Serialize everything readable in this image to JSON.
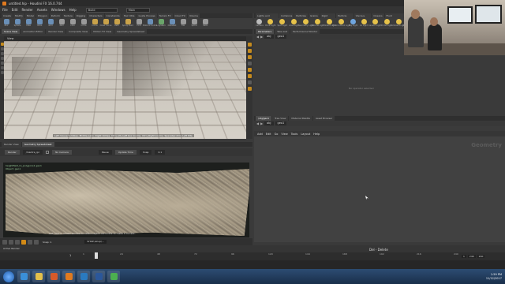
{
  "title_bar": {
    "title": "untitled.hip - Houdini FX 16.0.744"
  },
  "menu": {
    "items": [
      "File",
      "Edit",
      "Render",
      "Assets",
      "Windows",
      "Help"
    ],
    "desktop": "Build",
    "main_dropdown": "Main"
  },
  "shelf_tabs": [
    "Create",
    "Modify",
    "Model",
    "Polygon",
    "Deform",
    "Texture",
    "Rigging",
    "Characters",
    "Constraints",
    "Hair Utils",
    "Guide Process",
    "Terrain FX",
    "Cloud FX",
    "Volume"
  ],
  "shelf_tools": [
    {
      "label": "Box",
      "color": "#6a8fb7"
    },
    {
      "label": "Sphere",
      "color": "#6a8fb7"
    },
    {
      "label": "Tube",
      "color": "#6a8fb7"
    },
    {
      "label": "Torus",
      "color": "#6a8fb7"
    },
    {
      "label": "Grid",
      "color": "#6a8fb7"
    },
    {
      "label": "Null",
      "color": "#9a9a9a"
    },
    {
      "label": "Line",
      "color": "#9a9a9a"
    },
    {
      "label": "Circle",
      "color": "#9a9a9a"
    },
    {
      "label": "Curve",
      "color": "#c9a24a"
    },
    {
      "label": "Draw Curve",
      "color": "#c9a24a"
    },
    {
      "label": "Path",
      "color": "#c9a24a"
    },
    {
      "label": "Spray Paint",
      "color": "#c9a24a"
    },
    {
      "label": "Font",
      "color": "#9a9a9a"
    },
    {
      "label": "Platonic Solids",
      "color": "#6a8fb7"
    },
    {
      "label": "L-System",
      "color": "#6aa56a"
    },
    {
      "label": "Metaball",
      "color": "#6a8fb7"
    },
    {
      "label": "File",
      "color": "#9a9a9a"
    },
    {
      "label": "Spiral",
      "color": "#9a9a9a"
    },
    {
      "label": "Helix",
      "color": "#9a9a9a"
    }
  ],
  "right_shelf_tabs": [
    "Lights and Cameras",
    "Collisions",
    "Particles",
    "Grains",
    "Rigid Bodies",
    "Particle Fluids",
    "Viscous Fluids",
    "Oceans",
    "Fluid Containers"
  ],
  "right_shelf_tools": [
    {
      "label": "Camera",
      "color": "#bbbbbb"
    },
    {
      "label": "Point Light",
      "color": "#e6c24a"
    },
    {
      "label": "Spot Light",
      "color": "#e6c24a"
    },
    {
      "label": "Area Light",
      "color": "#e6c24a"
    },
    {
      "label": "Geometry Light",
      "color": "#e6c24a"
    },
    {
      "label": "Volume Light",
      "color": "#e6c24a"
    },
    {
      "label": "Distant Light",
      "color": "#e6c24a"
    },
    {
      "label": "Environment Light",
      "color": "#e6c24a"
    },
    {
      "label": "Sky Light",
      "color": "#6fa6e0"
    },
    {
      "label": "GI Light",
      "color": "#e6c24a"
    },
    {
      "label": "Caustic Light",
      "color": "#e6c24a"
    },
    {
      "label": "Portal Light",
      "color": "#e6c24a"
    },
    {
      "label": "Ambient Light",
      "color": "#e6c24a"
    },
    {
      "label": "Stereo Camera",
      "color": "#bbbbbb"
    }
  ],
  "left_pane": {
    "tabs": [
      "Scene View",
      "Animation Editor",
      "Render View",
      "Composite View",
      "Motion FX View",
      "Geometry Spreadsheet"
    ],
    "path": "obj",
    "node": "geo1",
    "view_label": "View",
    "hint": "Left mouse tumbles. Middle pans. Right dollies. Ctrl+Alt+Left box zooms. Ctrl+Right zooms. Spacebar-Ctrl+Left tilts."
  },
  "scene_view": {
    "tabs": [
      "Render View",
      "Geometry Spreadsheet"
    ],
    "render_button": "Render",
    "target": "/mantra_ipr",
    "camera_button": "No Camera",
    "pause_label": "Pause",
    "update_label": "Update Time",
    "snap_label": "Snap",
    "snap_value": "0.1",
    "label1": "heightfield_to_polygons1 geo1",
    "label2": "Object: geo1",
    "hint": "Left click in render window to select object. Ctrl+click to make it current."
  },
  "right_top_pane": {
    "tabs": [
      "Parameters",
      "Take List",
      "Performance Monitor"
    ],
    "path": "obj",
    "node": "geo1",
    "empty_text": "No operator selected"
  },
  "network_pane": {
    "tabs": [
      "/obj/geo1",
      "Tree View",
      "Material Palette",
      "Asset Browser"
    ],
    "path": "obj",
    "node": "geo1",
    "menu": [
      "Add",
      "Edit",
      "Go",
      "View",
      "Tools",
      "Layout",
      "Help"
    ],
    "watermark": "Geometry"
  },
  "playbar": {
    "buttons": [
      "first",
      "prev-key",
      "stop",
      "play",
      "next-key",
      "last"
    ],
    "snap": "Snap: 1",
    "current_frame": "1",
    "frame_range_start": "1",
    "frame_range_end": "240",
    "end_frame": "240",
    "ticks": [
      "1",
      "24",
      "48",
      "72",
      "96",
      "120",
      "144",
      "168",
      "192",
      "216",
      "240"
    ],
    "auto_update": "Auto Update",
    "obj_path": "SHOP:/shop/..."
  },
  "status": {
    "text": "Del - Delete",
    "active_render": "Active Render"
  },
  "taskbar": {
    "apps": [
      {
        "name": "ie",
        "color": "#3a8fd8"
      },
      {
        "name": "explorer",
        "color": "#e3c04b"
      },
      {
        "name": "media",
        "color": "#d65a2a"
      },
      {
        "name": "houdini",
        "color": "#e07a1f"
      },
      {
        "name": "ps",
        "color": "#2a7ac0"
      },
      {
        "name": "word",
        "color": "#2b579a"
      },
      {
        "name": "chrome",
        "color": "#4caf50"
      }
    ],
    "time": "1:59 PM",
    "date": "11/12/2017"
  }
}
